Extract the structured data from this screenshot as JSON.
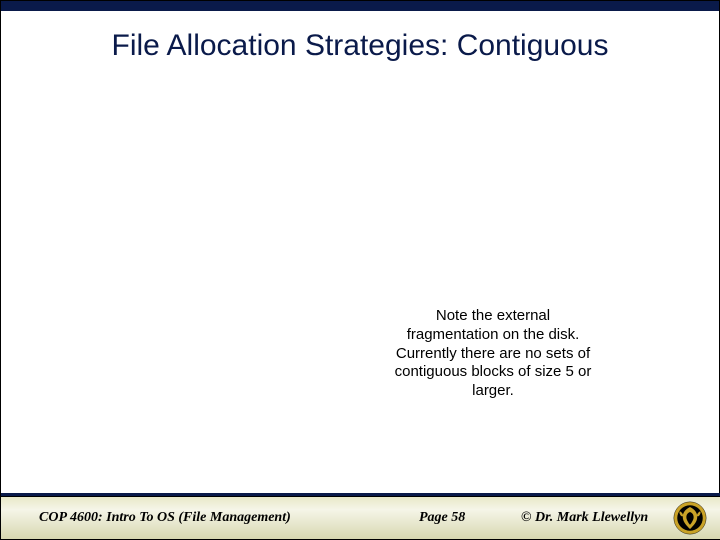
{
  "slide": {
    "title": "File Allocation Strategies: Contiguous",
    "note": "Note the external fragmentation on the disk.  Currently there are no sets of contiguous blocks of size 5 or larger."
  },
  "footer": {
    "course": "COP 4600: Intro To OS  (File Management)",
    "page": "Page 58",
    "author": "© Dr. Mark Llewellyn"
  },
  "colors": {
    "brand_dark": "#0a1a4a",
    "logo_gold": "#c9a227"
  }
}
